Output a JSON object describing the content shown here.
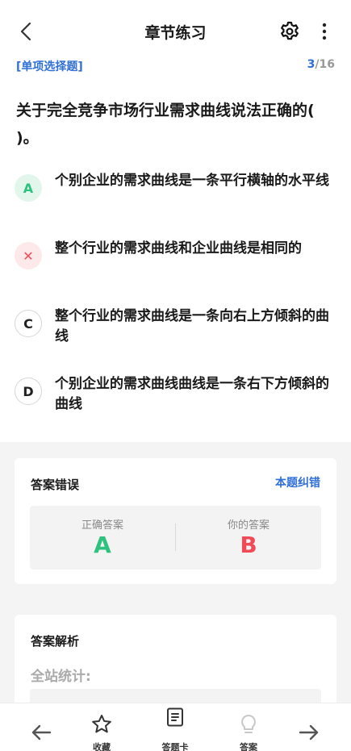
{
  "header": {
    "title": "章节练习"
  },
  "question": {
    "type_label": "[单项选择题]",
    "current": "3",
    "total": "/16",
    "stem": "关于完全竞争市场行业需求曲线说法正确的( )。"
  },
  "options": [
    {
      "badge": "A",
      "state": "correct",
      "text": "个别企业的需求曲线是一条平行横轴的水平线"
    },
    {
      "badge": "✕",
      "state": "wrong",
      "text": "整个行业的需求曲线和企业曲线是相同的"
    },
    {
      "badge": "C",
      "state": "normal",
      "text": "整个行业的需求曲线是一条向右上方倾斜的曲线"
    },
    {
      "badge": "D",
      "state": "normal",
      "text": "个别企业的需求曲线曲线是一条右下方倾斜的曲线"
    }
  ],
  "result": {
    "title": "答案错误",
    "report_link": "本题纠错",
    "correct_label": "正确答案",
    "correct_value": "A",
    "yours_label": "你的答案",
    "yours_value": "B"
  },
  "analysis": {
    "title": "答案解析",
    "stats_label": "全站统计:"
  },
  "bottom_nav": {
    "favorite": "收藏",
    "answer_card": "答题卡",
    "answer": "答案"
  },
  "colors": {
    "accent": "#2f6fd6",
    "correct": "#2ec27e",
    "wrong": "#ef4a55"
  }
}
